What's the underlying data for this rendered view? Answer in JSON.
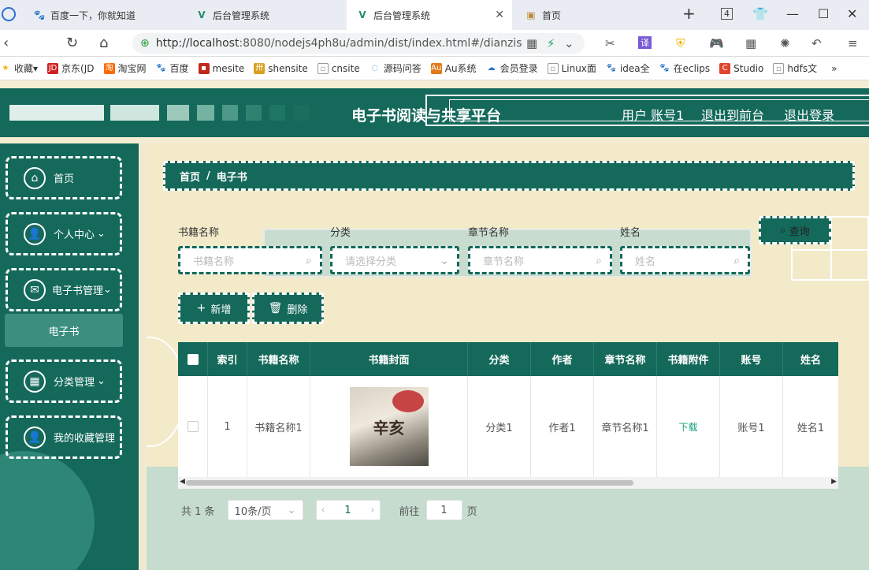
{
  "browser": {
    "tabs": [
      {
        "title": "百度一下，你就知道",
        "icon": "baidu-paw-icon"
      },
      {
        "title": "后台管理系统",
        "icon": "vue-logo-icon"
      },
      {
        "title": "后台管理系统",
        "icon": "vue-logo-icon"
      },
      {
        "title": "首页",
        "icon": "page-image-icon"
      }
    ],
    "tab_count": "4",
    "url_host": "http://localhost",
    "url_rest": ":8080/nodejs4ph8u/admin/dist/index.html#/dianzis",
    "bookmarks": [
      "收藏",
      "京东(JD",
      "淘宝网",
      "百度",
      "mesite",
      "shensite",
      "cnsite",
      "源码问答",
      "Au系统",
      "会员登录",
      "Linux面",
      "idea全",
      "在eclips",
      "Studio",
      "hdfs文"
    ]
  },
  "header": {
    "title": "电子书阅读与共享平台",
    "user_label": "用户 账号1",
    "to_front": "退出到前台",
    "logout": "退出登录"
  },
  "sidebar": {
    "items": [
      {
        "label": "首页",
        "icon": "home-icon"
      },
      {
        "label": "个人中心",
        "icon": "user-icon",
        "chevron": "⌄"
      },
      {
        "label": "电子书管理",
        "icon": "book-icon",
        "chevron": "⌄"
      },
      {
        "label": "分类管理",
        "icon": "grid-icon",
        "chevron": "⌄"
      },
      {
        "label": "我的收藏管理",
        "icon": "person-icon"
      }
    ],
    "sub_item": "电子书"
  },
  "breadcrumb": {
    "home": "首页",
    "sep": "/",
    "current": "电子书"
  },
  "filters": {
    "labels": [
      "书籍名称",
      "分类",
      "章节名称",
      "姓名"
    ],
    "placeholders": [
      "书籍名称",
      "请选择分类",
      "章节名称",
      "姓名"
    ],
    "query": "查询"
  },
  "actions": {
    "add": "新增",
    "delete": "删除"
  },
  "table": {
    "headers": [
      "索引",
      "书籍名称",
      "书籍封面",
      "分类",
      "作者",
      "章节名称",
      "书籍附件",
      "账号",
      "姓名"
    ],
    "row": {
      "index": "1",
      "name": "书籍名称1",
      "cover_text": "辛亥",
      "category": "分类1",
      "author": "作者1",
      "chapter": "章节名称1",
      "attachment": "下载",
      "account": "账号1",
      "realname": "姓名1"
    }
  },
  "pagination": {
    "total": "共 1 条",
    "page_size": "10条/页",
    "current_page": "1",
    "goto_label": "前往",
    "goto_value": "1",
    "page_unit": "页"
  },
  "colors": {
    "primary": "#14695a",
    "background": "#f2eac9",
    "link": "#14a07a"
  }
}
